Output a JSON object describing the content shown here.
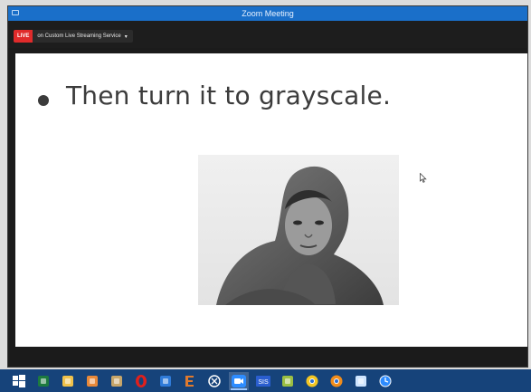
{
  "window": {
    "title": "Zoom Meeting"
  },
  "live": {
    "badge": "LIVE",
    "service": "on Custom Live Streaming Service",
    "caret": "▾"
  },
  "slide": {
    "bullet_text": "Then turn it to grayscale."
  },
  "taskbar": {
    "items": [
      {
        "name": "start-icon",
        "color": "#ffffff"
      },
      {
        "name": "excel-icon",
        "color": "#1d7a3f"
      },
      {
        "name": "file-explorer-icon",
        "color": "#f0c24b"
      },
      {
        "name": "paint-icon",
        "color": "#e8893a"
      },
      {
        "name": "art-tool-icon",
        "color": "#c7a66a"
      },
      {
        "name": "opera-icon",
        "color": "#e0201c"
      },
      {
        "name": "app-icon",
        "color": "#2f7bd9"
      },
      {
        "name": "letter-e-icon",
        "color": "#e07a2d"
      },
      {
        "name": "chrome-like-icon",
        "color": "#ffffff"
      },
      {
        "name": "zoom-icon",
        "color": "#2d8cff"
      },
      {
        "name": "sis-icon",
        "color": "#2a5ecf"
      },
      {
        "name": "brush-icon",
        "color": "#9bbf43"
      },
      {
        "name": "chrome-icon",
        "color": "#f3c623"
      },
      {
        "name": "chrome-alt-icon",
        "color": "#f08c1b"
      },
      {
        "name": "monitor-icon",
        "color": "#cfe5ff"
      },
      {
        "name": "clock-icon",
        "color": "#2d8cff"
      }
    ]
  }
}
